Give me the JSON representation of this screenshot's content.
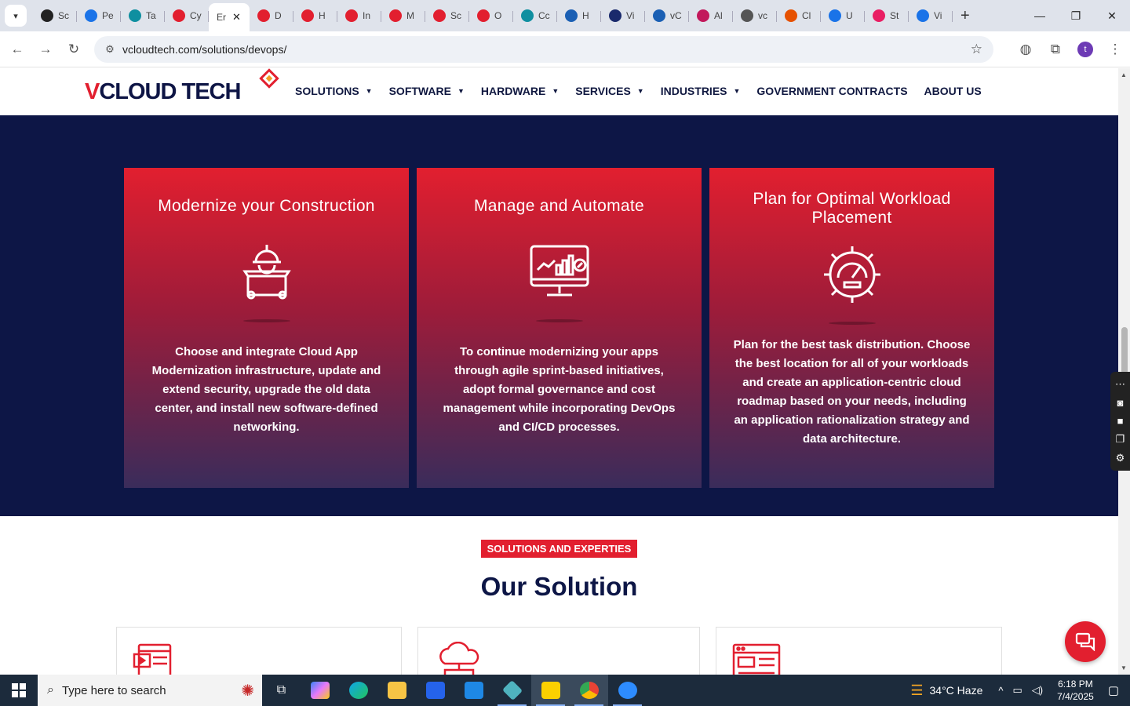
{
  "browser": {
    "tabs": [
      {
        "label": "Sc",
        "color": "#222222"
      },
      {
        "label": "Pe",
        "color": "#1a73e8"
      },
      {
        "label": "Ta",
        "color": "#0f8fa0"
      },
      {
        "label": "Cy",
        "color": "#e21f2f"
      },
      {
        "label": "Er",
        "color": "#ffffff",
        "active": true
      },
      {
        "label": "D",
        "color": "#e21f2f"
      },
      {
        "label": "H",
        "color": "#e21f2f"
      },
      {
        "label": "In",
        "color": "#e21f2f"
      },
      {
        "label": "M",
        "color": "#e21f2f"
      },
      {
        "label": "Sc",
        "color": "#e21f2f"
      },
      {
        "label": "O",
        "color": "#e21f2f"
      },
      {
        "label": "Cc",
        "color": "#0f8fa0"
      },
      {
        "label": "H",
        "color": "#1a5fb4"
      },
      {
        "label": "Vi",
        "color": "#1a2a6c"
      },
      {
        "label": "vC",
        "color": "#1a5fb4"
      },
      {
        "label": "Al",
        "color": "#c2185b"
      },
      {
        "label": "vc",
        "color": "#555555"
      },
      {
        "label": "Cl",
        "color": "#e65100"
      },
      {
        "label": "U",
        "color": "#1a73e8"
      },
      {
        "label": "St",
        "color": "#e91e63"
      },
      {
        "label": "Vi",
        "color": "#1a73e8"
      }
    ],
    "close_glyph": "✕",
    "new_tab": "+",
    "url": "vcloudtech.com/solutions/devops/",
    "profile_initial": "t"
  },
  "site": {
    "logo_v": "V",
    "logo_rest": "CLOUD TECH",
    "nav": [
      {
        "label": "SOLUTIONS",
        "dropdown": true
      },
      {
        "label": "SOFTWARE",
        "dropdown": true
      },
      {
        "label": "HARDWARE",
        "dropdown": true
      },
      {
        "label": "SERVICES",
        "dropdown": true
      },
      {
        "label": "INDUSTRIES",
        "dropdown": true
      },
      {
        "label": "GOVERNMENT CONTRACTS",
        "dropdown": false
      },
      {
        "label": "ABOUT US",
        "dropdown": false
      }
    ],
    "cards": [
      {
        "title": "Modernize your Construction",
        "icon": "construction-worker-icon",
        "text": "Choose and integrate Cloud App Modernization infrastructure, update and extend security, upgrade the old data center, and install new software-defined networking."
      },
      {
        "title": "Manage and Automate",
        "icon": "monitor-chart-icon",
        "text": "To continue modernizing your apps through agile sprint-based initiatives, adopt formal governance and cost management while incorporating DevOps and CI/CD processes."
      },
      {
        "title": "Plan for Optimal Workload Placement",
        "icon": "gear-gauge-icon",
        "text": "Plan for the best task distribution. Choose the best location for all of your workloads and create an application-centric cloud roadmap based on your needs, including an application rationalization strategy and data architecture."
      }
    ],
    "badge": "SOLUTIONS AND EXPERTIES",
    "section_title": "Our Solution"
  },
  "taskbar": {
    "search_placeholder": "Type here to search",
    "weather": "34°C  Haze",
    "time": "6:18 PM",
    "date": "7/4/2025"
  },
  "colors": {
    "brand_red": "#e21f2f",
    "navy": "#0d1646"
  }
}
